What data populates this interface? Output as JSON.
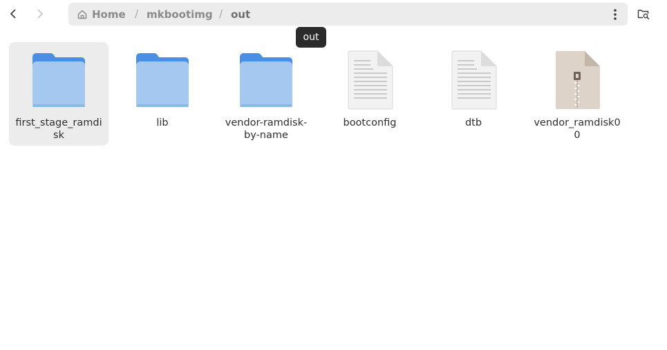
{
  "toolbar": {
    "back_icon": "chevron-left-icon",
    "forward_icon": "chevron-right-icon",
    "menu_icon": "vertical-dots-icon",
    "search_icon": "folder-search-icon"
  },
  "pathbar": {
    "home_icon": "home-icon",
    "home_label": "Home",
    "separator": "/",
    "crumbs": [
      "mkbootimg",
      "out"
    ]
  },
  "tooltip": {
    "text": "out"
  },
  "files": [
    {
      "name_line1": "first_stage_ramdi",
      "name_line2": "sk",
      "type": "folder",
      "icon": "folder-icon",
      "selected": true
    },
    {
      "name_line1": "lib",
      "name_line2": "",
      "type": "folder",
      "icon": "folder-icon",
      "selected": false
    },
    {
      "name_line1": "vendor-ramdisk-",
      "name_line2": "by-name",
      "type": "folder",
      "icon": "folder-icon",
      "selected": false
    },
    {
      "name_line1": "bootconfig",
      "name_line2": "",
      "type": "text-file",
      "icon": "text-file-icon",
      "selected": false
    },
    {
      "name_line1": "dtb",
      "name_line2": "",
      "type": "text-file",
      "icon": "text-file-icon",
      "selected": false
    },
    {
      "name_line1": "vendor_ramdisk0",
      "name_line2": "0",
      "type": "archive",
      "icon": "archive-file-icon",
      "selected": false
    }
  ],
  "colors": {
    "folder_front": "#a4c8ef",
    "folder_back": "#4a8ee6",
    "selection": "#ececec",
    "pathbar": "#ececec",
    "tooltip": "#2b2b2b"
  }
}
